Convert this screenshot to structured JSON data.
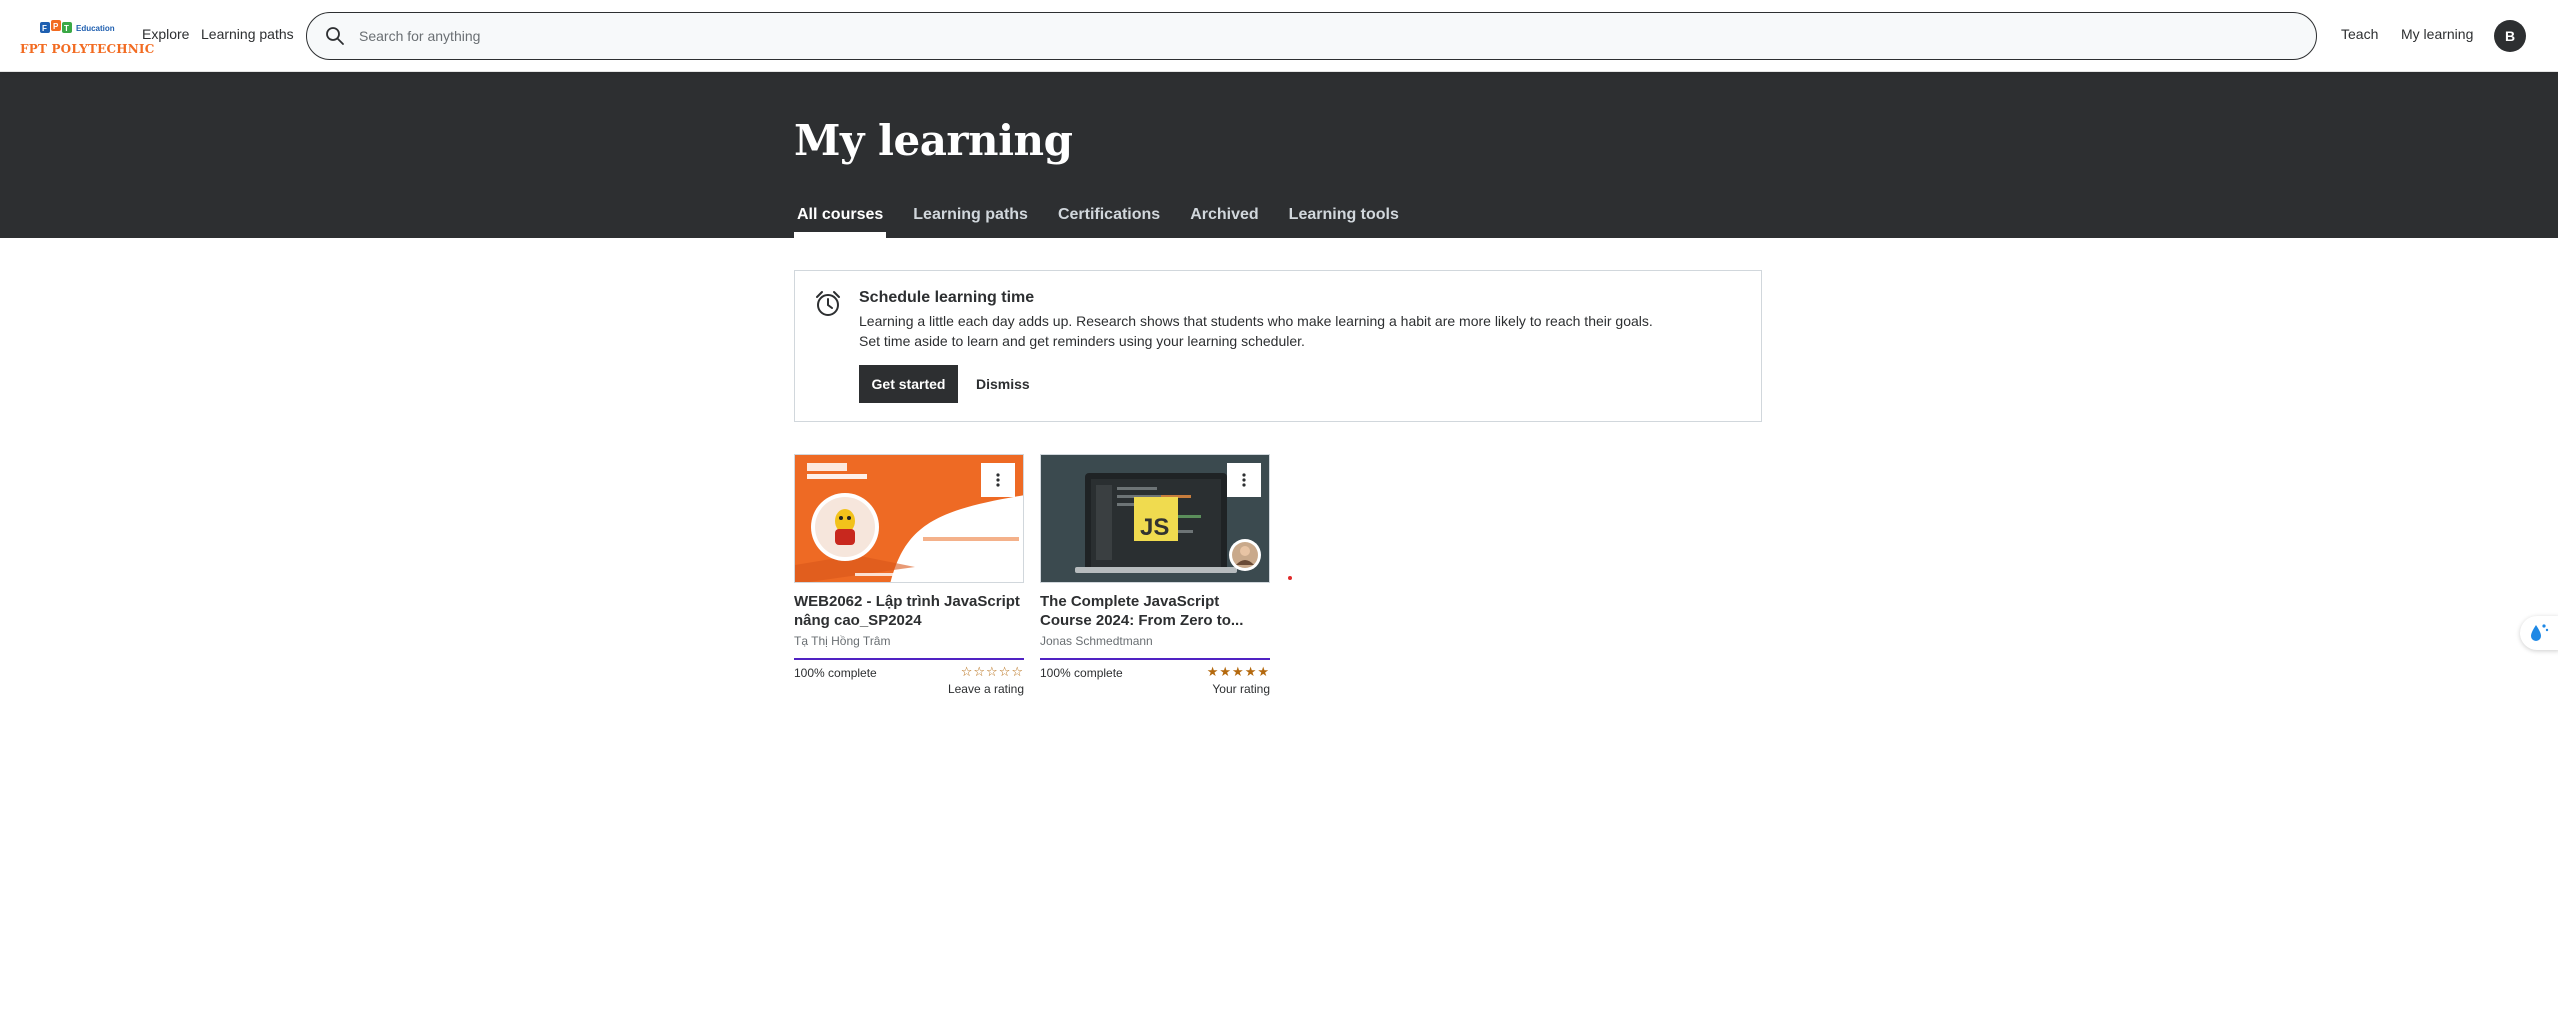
{
  "header": {
    "logo_brand": "FPT Education",
    "logo_text": "FPT POLYTECHNIC",
    "nav_explore": "Explore",
    "nav_learning_paths": "Learning paths",
    "search_placeholder": "Search for anything",
    "teach": "Teach",
    "my_learning": "My learning",
    "avatar_initial": "B"
  },
  "page": {
    "title": "My learning",
    "tabs": [
      {
        "label": "All courses",
        "active": true
      },
      {
        "label": "Learning paths",
        "active": false
      },
      {
        "label": "Certifications",
        "active": false
      },
      {
        "label": "Archived",
        "active": false
      },
      {
        "label": "Learning tools",
        "active": false
      }
    ]
  },
  "schedule": {
    "title": "Schedule learning time",
    "line1": "Learning a little each day adds up. Research shows that students who make learning a habit are more likely to reach their goals.",
    "line2": "Set time aside to learn and get reminders using your learning scheduler.",
    "primary_button": "Get started",
    "dismiss_button": "Dismiss"
  },
  "courses": [
    {
      "title": "WEB2062 - Lập trình JavaScript nâng cao_SP2024",
      "instructor": "Tạ Thị Hồng Trâm",
      "progress_text": "100% complete",
      "progress": 1.0,
      "rating": 0,
      "rating_label": "Leave a rating",
      "thumb_small_text": "LẬP TRÌNH JAVASCRIPT NÂNG CAO"
    },
    {
      "title": "The Complete JavaScript Course 2024: From Zero to...",
      "instructor": "Jonas Schmedtmann",
      "progress_text": "100% complete",
      "progress": 1.0,
      "rating": 5,
      "rating_label": "Your rating",
      "thumb_badge": "JS"
    }
  ],
  "colors": {
    "hero_bg": "#2d2f31",
    "progress": "#5022c3",
    "star": "#b4690e",
    "brand_orange": "#f26b21"
  }
}
